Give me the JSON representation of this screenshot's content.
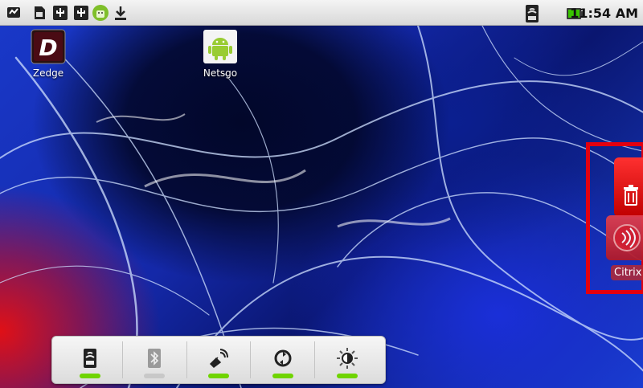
{
  "statusbar": {
    "left_icons": [
      "message-icon",
      "sd-card-icon",
      "usb-icon",
      "usb-icon",
      "android-debug-icon",
      "download-icon"
    ],
    "signal_icon": "wifi-icon",
    "battery_icon": "battery-icon",
    "time": "11:54 AM"
  },
  "desktop": {
    "shortcuts": [
      {
        "label": "Zedge",
        "icon": "zedge-app-icon"
      },
      {
        "label": "Netsgo",
        "icon": "android-app-icon"
      }
    ]
  },
  "widget": {
    "buttons": [
      {
        "name": "wifi-toggle",
        "icon": "wifi-icon",
        "state": "on"
      },
      {
        "name": "bluetooth-toggle",
        "icon": "bluetooth-icon",
        "state": "off"
      },
      {
        "name": "gps-toggle",
        "icon": "gps-icon",
        "state": "on"
      },
      {
        "name": "sync-toggle",
        "icon": "sync-icon",
        "state": "on"
      },
      {
        "name": "brightness-toggle",
        "icon": "brightness-icon",
        "state": "on"
      }
    ]
  },
  "drag": {
    "trash_icon": "trash-icon",
    "app_icon": "citrix-app-icon",
    "app_label": "Citrix"
  },
  "colors": {
    "accent_green": "#6fd400",
    "off_gray": "#c8c8c8",
    "highlight_red": "#e3000f"
  }
}
